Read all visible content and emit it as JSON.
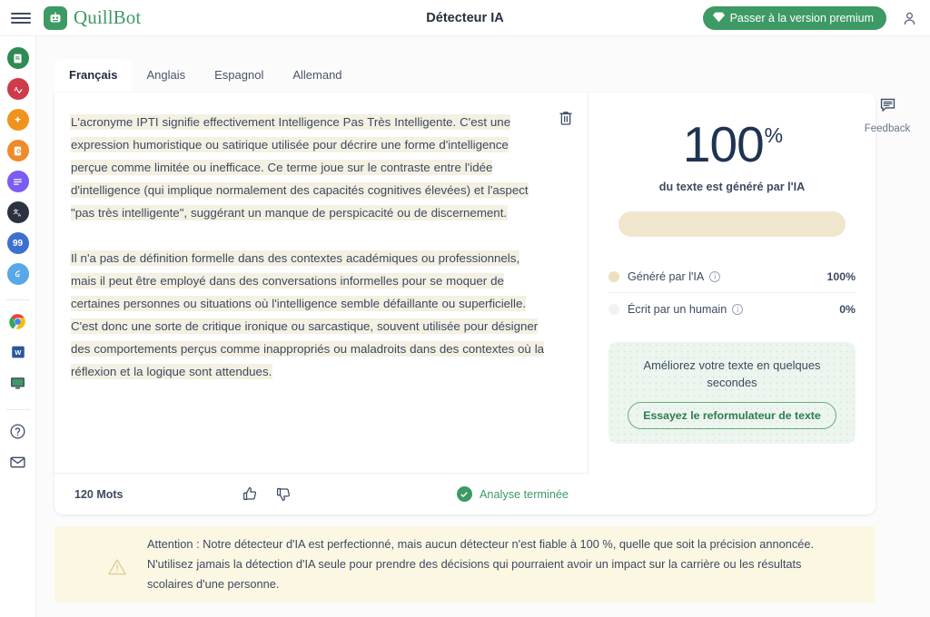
{
  "topbar": {
    "menu_icon": "hamburger-icon",
    "brand_name": "QuillBot",
    "brand_icon": "quillbot-logo-icon",
    "page_title": "Détecteur IA",
    "premium_label": "Passer à la version premium",
    "premium_icon": "diamond-icon",
    "premium_color": "#3d9a64",
    "account_icon": "user-account-icon"
  },
  "sidebar": {
    "items": [
      {
        "name": "grammar-checker",
        "icon": "document-check-icon",
        "color": "#2f8a56",
        "active": false
      },
      {
        "name": "paraphraser",
        "icon": "letter-a-check-icon",
        "color": "#cf3b4b",
        "active": false
      },
      {
        "name": "ai-detector",
        "icon": "ai-sparkle-icon",
        "color": "#f0931e",
        "active": true
      },
      {
        "name": "plagiarism-checker",
        "icon": "page-search-icon",
        "color": "#ef8b2c",
        "active": false
      },
      {
        "name": "summarizer",
        "icon": "summarize-lines-icon",
        "color": "#7a5cf0",
        "active": false
      },
      {
        "name": "translator",
        "icon": "translate-icon",
        "color": "#2b3240",
        "active": false
      },
      {
        "name": "citation-generator",
        "icon": "quotes-icon",
        "color": "#3d6fd1",
        "active": false
      },
      {
        "name": "flow",
        "icon": "flow-pen-icon",
        "color": "#5aa7e8",
        "active": false
      }
    ],
    "apps": [
      {
        "name": "chrome-extension",
        "icon": "chrome-icon"
      },
      {
        "name": "word-addin",
        "icon": "word-icon"
      },
      {
        "name": "desktop-app",
        "icon": "desktop-icon"
      }
    ],
    "utility": [
      {
        "name": "help",
        "icon": "question-circle-icon"
      },
      {
        "name": "contact",
        "icon": "envelope-icon"
      }
    ]
  },
  "tabs": [
    {
      "label": "Français",
      "active": true
    },
    {
      "label": "Anglais",
      "active": false
    },
    {
      "label": "Espagnol",
      "active": false
    },
    {
      "label": "Allemand",
      "active": false
    }
  ],
  "editor": {
    "trash_icon": "trash-icon",
    "paragraphs": [
      "L'acronyme IPTI signifie effectivement Intelligence Pas Très Intelligente. C'est une expression humoristique ou satirique utilisée pour décrire une forme d'intelligence perçue comme limitée ou inefficace. Ce terme joue sur le contraste entre l'idée d'intelligence (qui implique normalement des capacités cognitives élevées) et l'aspect \"pas très intelligente\", suggérant un manque de perspicacité ou de discernement.",
      "Il n'a pas de définition formelle dans des contextes académiques ou professionnels, mais il peut être employé dans des conversations informelles pour se moquer de certaines personnes ou situations où l'intelligence semble défaillante ou superficielle. C'est donc une sorte de critique ironique ou sarcastique, souvent utilisée pour désigner des comportements perçus comme inappropriés ou maladroits dans des contextes où la réflexion et la logique sont attendues."
    ],
    "highlight_color": "#f4f0e2",
    "word_count": "120 Mots",
    "thumb_up_icon": "thumbs-up-icon",
    "thumb_down_icon": "thumbs-down-icon",
    "status_label": "Analyse terminée",
    "status_icon": "check-circle-icon",
    "status_color": "#3d9a64"
  },
  "results": {
    "score_value": "100",
    "score_unit": "%",
    "score_caption": "du texte est généré par l'IA",
    "bar_color": "#efe6cd",
    "bar_fill_percent": 100,
    "legend": [
      {
        "label": "Généré par l'IA",
        "value": "100%",
        "dot_color": "#ede0bc",
        "info_icon": "info-icon"
      },
      {
        "label": "Écrit par un humain",
        "value": "0%",
        "dot_color": "#f1f2f4",
        "info_icon": "info-icon"
      }
    ],
    "promo_title": "Améliorez votre texte en quelques secondes",
    "promo_button": "Essayez le reformulateur de texte",
    "promo_bg": "#edf6ee"
  },
  "feedback": {
    "label": "Feedback",
    "icon": "comment-box-icon"
  },
  "warning": {
    "icon": "warning-triangle-icon",
    "bg_color": "#fcf7e3",
    "text": "Attention : Notre détecteur d'IA est perfectionné, mais aucun détecteur n'est fiable à 100 %, quelle que soit la précision annoncée. N'utilisez jamais la détection d'IA seule pour prendre des décisions qui pourraient avoir un impact sur la carrière ou les résultats scolaires d'une personne."
  }
}
